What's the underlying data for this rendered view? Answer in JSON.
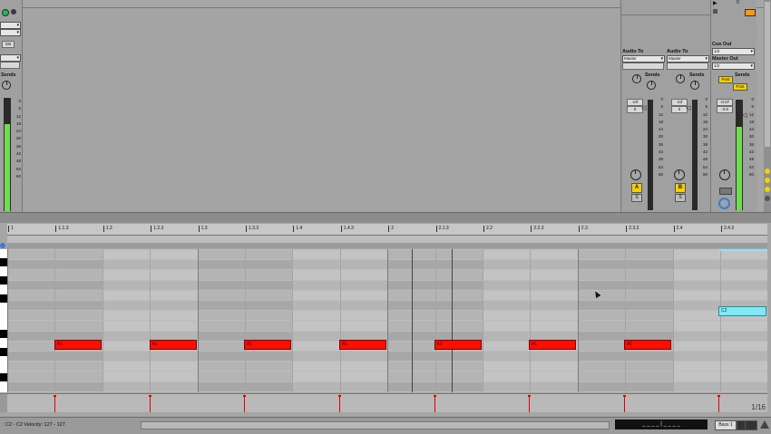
{
  "session": {
    "send_labels": [
      "Sends",
      "Sends",
      "Sends",
      "Sends"
    ],
    "audio_to_label": "Audio To",
    "audio_to_value": "Master",
    "cue_out_label": "Cue Out",
    "cue_out_value": "1/2",
    "master_out_label": "Master Out",
    "master_out_value": "1/2",
    "post_label": "Post",
    "left_field_value": "GB",
    "meter_scale": [
      "0",
      "6",
      "12",
      "18",
      "24",
      "30",
      "36",
      "42",
      "48",
      "54",
      "60"
    ],
    "track_a": {
      "volume": "-inf",
      "pan": "0",
      "activator": "A",
      "solo": "S"
    },
    "track_b": {
      "volume": "-inf",
      "pan": "0",
      "activator": "B",
      "solo": "S"
    },
    "master": {
      "volume": "-0.07",
      "pan": "-3.9"
    },
    "play_icon": "▶",
    "top_count": "0"
  },
  "ruler": {
    "ticks": [
      "1",
      "1.1.3",
      "1.2",
      "1.2.3",
      "1.3",
      "1.3.3",
      "1.4",
      "1.4.3",
      "2",
      "2.1.3",
      "2.2",
      "2.2.3",
      "2.3",
      "2.3.3",
      "2.4",
      "2.4.3"
    ]
  },
  "clip": {
    "notes": [
      {
        "label": "A1"
      },
      {
        "label": "A1"
      },
      {
        "label": "A1"
      },
      {
        "label": "A1"
      },
      {
        "label": "A1"
      },
      {
        "label": "A1"
      },
      {
        "label": "A1"
      }
    ],
    "selected_note": {
      "label": "C2"
    },
    "page_counter": "1/16"
  },
  "status": {
    "text": ": C2 - C2   Velocity: 127 - 127",
    "arrange_label": "Bass 1",
    "time_display": "_ _ _ _ | _ _ _ _"
  },
  "colors": {
    "note": "#ff0e00",
    "selected_note": "#7fe9f4",
    "meter_fill": "#6fdc55",
    "activator": "#f5d000"
  }
}
